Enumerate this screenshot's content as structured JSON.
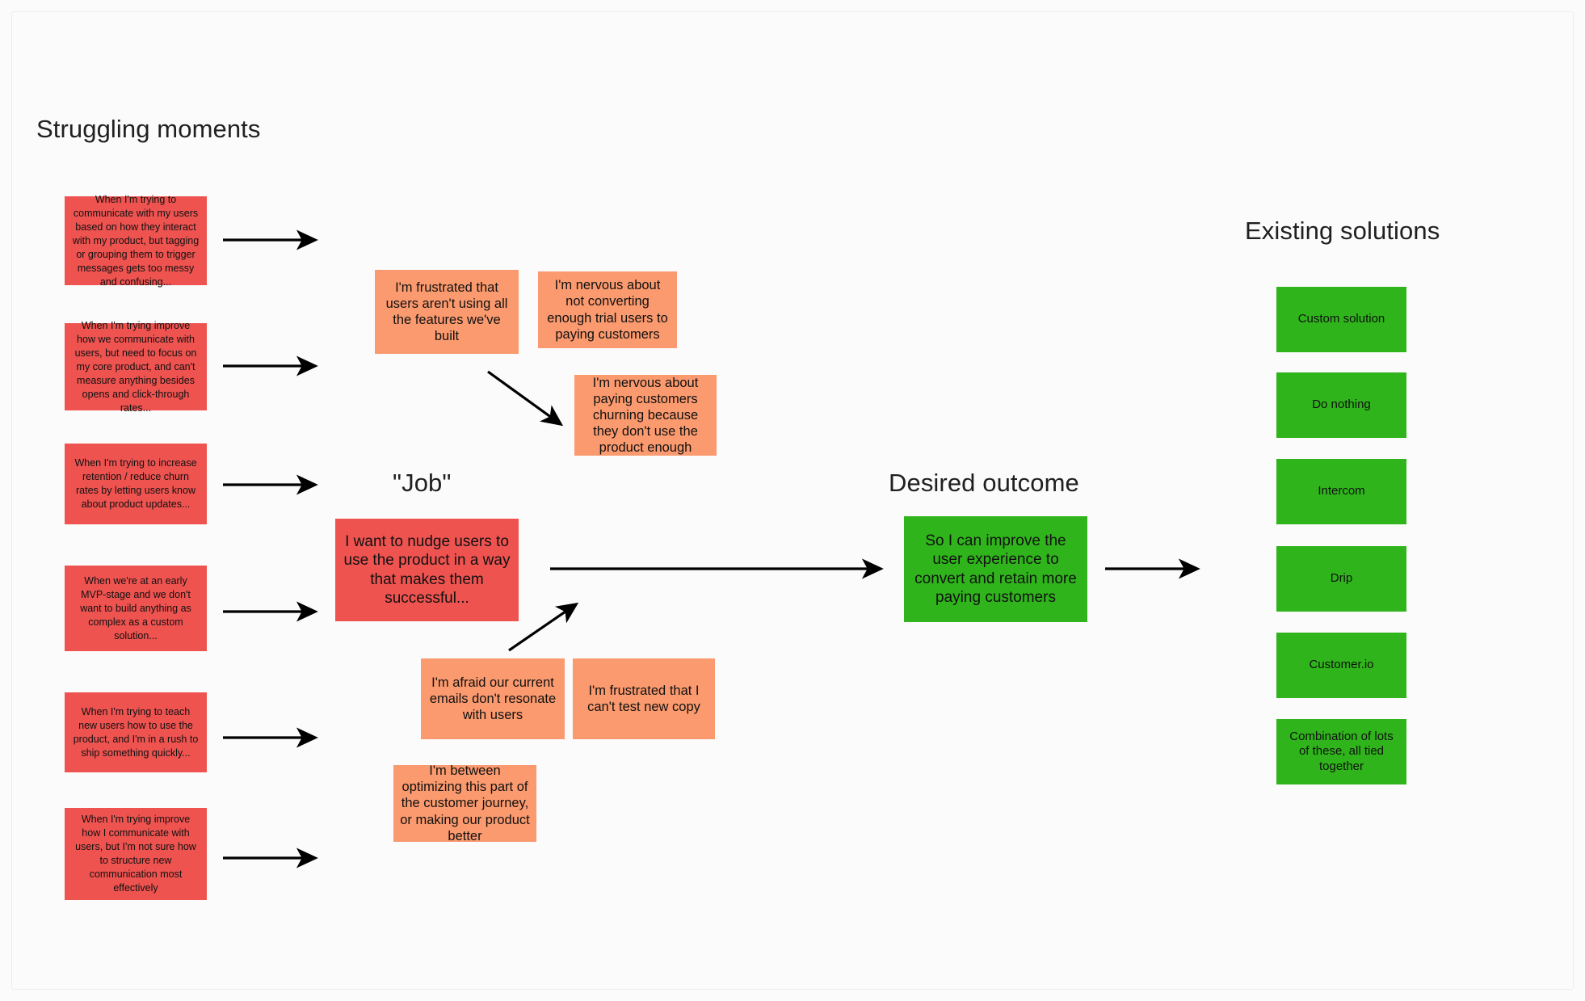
{
  "headings": {
    "struggling": "Struggling moments",
    "job": "\"Job\"",
    "desired": "Desired outcome",
    "existing": "Existing solutions"
  },
  "colors": {
    "red": "#ee5350",
    "orange": "#fb9a6e",
    "green": "#2fb51b",
    "background": "#fbfbfb",
    "arrow": "#000000"
  },
  "struggling_moments": [
    {
      "text": "When I'm trying to communicate with my users based on how they interact with my product, but tagging or grouping them to trigger messages gets too messy and confusing..."
    },
    {
      "text": "When I'm trying improve how we communicate with users, but need to focus on my core product, and can't measure anything besides opens and click-through rates..."
    },
    {
      "text": "When I'm trying to increase retention / reduce churn rates by letting users know about product updates..."
    },
    {
      "text": "When we're at an early MVP-stage and we don't want to build anything as complex as a custom solution..."
    },
    {
      "text": "When I'm trying to teach new users how to use the product, and I'm in a rush to ship something quickly..."
    },
    {
      "text": "When I'm trying improve how I communicate with users, but I'm not sure how to structure new communication most effectively"
    }
  ],
  "pains_top": [
    {
      "text": "I'm frustrated that users aren't using all the features we've built"
    },
    {
      "text": "I'm nervous about not converting enough trial users to paying customers"
    },
    {
      "text": "I'm nervous about paying customers churning because they don't use the product enough"
    }
  ],
  "pains_bottom": [
    {
      "text": "I'm afraid our current emails don't resonate with users"
    },
    {
      "text": "I'm frustrated that I can't test new copy"
    },
    {
      "text": "I'm between optimizing this part of the customer journey, or making our product better"
    }
  ],
  "job": {
    "text": "I want to nudge users to use the product in a way that makes them successful..."
  },
  "desired_outcome": {
    "text": "So I can improve the user experience to convert and retain more paying customers"
  },
  "existing_solutions": [
    {
      "text": "Custom solution"
    },
    {
      "text": "Do nothing"
    },
    {
      "text": "Intercom"
    },
    {
      "text": "Drip"
    },
    {
      "text": "Customer.io"
    },
    {
      "text": "Combination of lots of these, all tied together"
    }
  ]
}
